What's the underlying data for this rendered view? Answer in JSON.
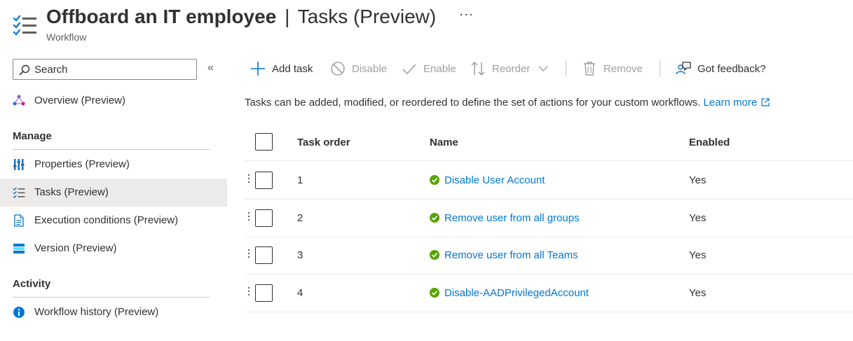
{
  "header": {
    "title_main": "Offboard an IT employee",
    "title_separator": "|",
    "title_section": "Tasks (Preview)",
    "subtitle": "Workflow",
    "more_label": "···",
    "icon": "tasks-list-icon"
  },
  "sidebar": {
    "search_placeholder": "Search",
    "collapse_label": "«",
    "overview": {
      "label": "Overview (Preview)",
      "icon": "overview-icon"
    },
    "sections": [
      {
        "title": "Manage",
        "items": [
          {
            "label": "Properties (Preview)",
            "icon": "properties-icon",
            "selected": false
          },
          {
            "label": "Tasks (Preview)",
            "icon": "tasks-icon",
            "selected": true
          },
          {
            "label": "Execution conditions (Preview)",
            "icon": "document-icon",
            "selected": false
          },
          {
            "label": "Version (Preview)",
            "icon": "version-icon",
            "selected": false
          }
        ]
      },
      {
        "title": "Activity",
        "items": [
          {
            "label": "Workflow history (Preview)",
            "icon": "info-icon",
            "selected": false
          }
        ]
      }
    ]
  },
  "toolbar": {
    "add_task": "Add task",
    "disable": "Disable",
    "enable": "Enable",
    "reorder": "Reorder",
    "remove": "Remove",
    "feedback": "Got feedback?"
  },
  "description": {
    "text": "Tasks can be added, modified, or reordered to define the set of actions for your custom workflows.",
    "link": "Learn more"
  },
  "table": {
    "columns": [
      "Task order",
      "Name",
      "Enabled"
    ],
    "rows": [
      {
        "order": "1",
        "name": "Disable User Account",
        "enabled": "Yes"
      },
      {
        "order": "2",
        "name": "Remove user from all groups",
        "enabled": "Yes"
      },
      {
        "order": "3",
        "name": "Remove user from all Teams",
        "enabled": "Yes"
      },
      {
        "order": "4",
        "name": "Disable-AADPrivilegedAccount",
        "enabled": "Yes"
      }
    ]
  },
  "colors": {
    "accent": "#0078d4",
    "success": "#57a300",
    "disabled": "#a19f9d",
    "selected_bg": "#edebe9"
  }
}
